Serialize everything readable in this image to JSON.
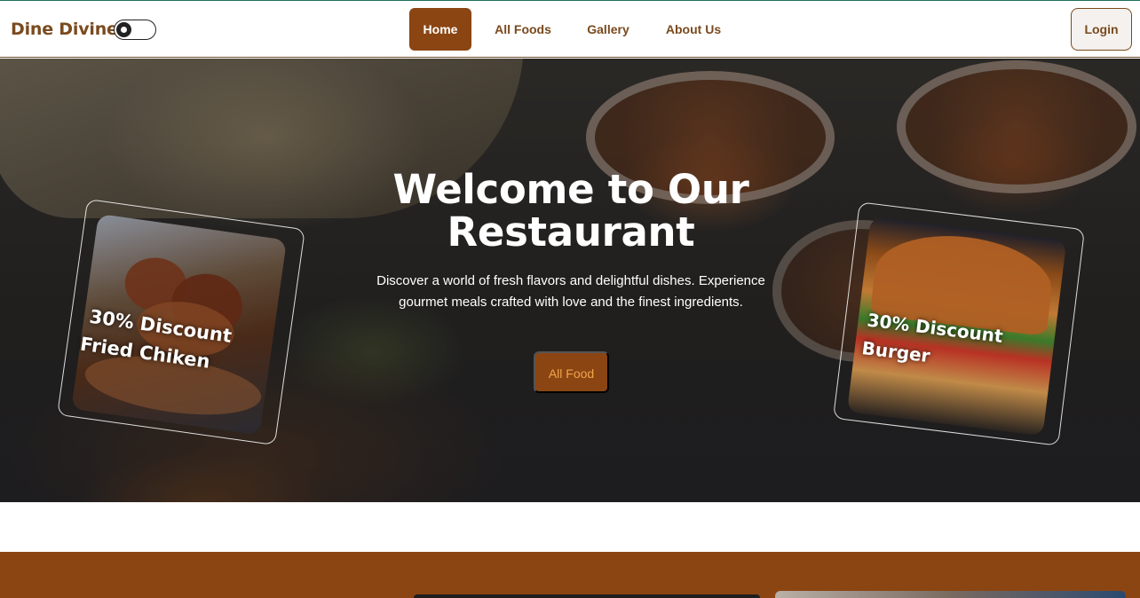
{
  "navbar": {
    "brand": "Dine Divine",
    "links": [
      "Home",
      "All Foods",
      "Gallery",
      "About Us"
    ],
    "active": "Home",
    "login_label": "Login"
  },
  "hero": {
    "title_line1": "Welcome to Our",
    "title_line2": "Restaurant",
    "description": "Discover a world of fresh flavors and delightful dishes. Experience gourmet meals crafted with love and the finest ingredients.",
    "cta_label": "All Food"
  },
  "promos": [
    {
      "line1": "30% Discount",
      "line2": "Fried Chiken"
    },
    {
      "line1": "30% Discount",
      "line2": "Burger"
    }
  ],
  "colors": {
    "brand_brown": "#8b4513",
    "text_brown": "#7a4a1e",
    "cta_text": "#f0a54a"
  }
}
